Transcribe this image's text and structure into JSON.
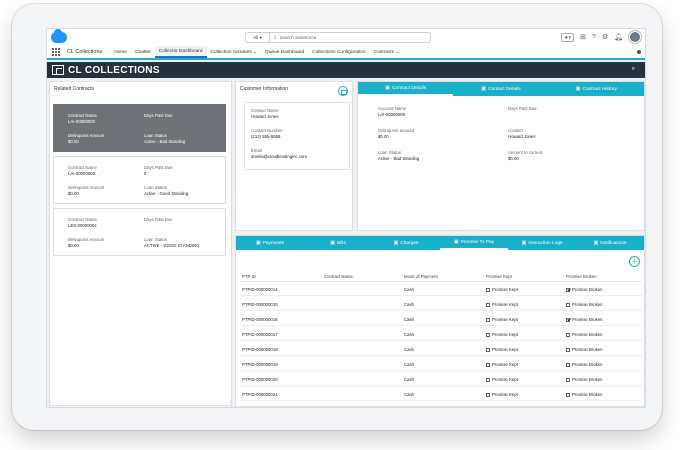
{
  "topbar": {
    "search_scope": "All",
    "search_placeholder": "Search Salesforce"
  },
  "nav": {
    "app_name": "CL Collections",
    "items": [
      "Home",
      "Chatter",
      "Collector Dashboard",
      "Collection Activities",
      "Queue Dashboard",
      "Collections Configuration",
      "Contracts"
    ],
    "active": "Collector Dashboard"
  },
  "header": {
    "title": "CL COLLECTIONS"
  },
  "related": {
    "title": "Related Contracts",
    "cards": [
      {
        "contract_name_label": "Contract Name",
        "contract_name": "LAI-00000000",
        "days_past_due_label": "Days Past Due",
        "days_past_due": "",
        "delinquent_label": "Delinquent Amount",
        "delinquent": "$0.00",
        "status_label": "Loan Status",
        "status": "Active - Bad Standing"
      },
      {
        "contract_name_label": "Contract Name",
        "contract_name": "LAI-00000003",
        "days_past_due_label": "Days Past Due",
        "days_past_due": "0",
        "delinquent_label": "Delinquent Amount",
        "delinquent": "$0.00",
        "status_label": "Loan Status",
        "status": "Active - Good Standing"
      },
      {
        "contract_name_label": "Contract Name",
        "contract_name": "LES-00000004",
        "days_past_due_label": "Days Past Due",
        "days_past_due": "",
        "delinquent_label": "Delinquent Amount",
        "delinquent": "$0.00",
        "status_label": "Loan Status",
        "status": "ACTIVE - GOOD STANDING"
      }
    ]
  },
  "customer": {
    "title": "Customer Information",
    "name_label": "Contact Name",
    "name": "Howard Jones",
    "number_label": "Contact Number",
    "number": "(212) 555-5559",
    "email_label": "Email",
    "email": "amelia@cloudlendinginc.com"
  },
  "contract_tabs": [
    "Contract Details",
    "Contact Details",
    "Contract History"
  ],
  "contract_details": {
    "account_name_label": "Account Name",
    "account_name": "LAI-00000000",
    "days_past_due_label": "Days Past Due",
    "days_past_due": "",
    "delinquent_label": "Delinquent amount",
    "delinquent": "$0.00",
    "contact_label": "Contact",
    "contact": "Howard Jones",
    "loan_status_label": "Loan Status",
    "loan_status": "Active - Bad Standing",
    "amount_label": "Amount to current",
    "amount": "$0.00"
  },
  "lower_tabs": [
    "Payments",
    "Bills",
    "Charges",
    "Promise To Pay",
    "Interaction Logs",
    "Notifications"
  ],
  "promise_table": {
    "columns": [
      "PTP ID",
      "Contract Name",
      "Mode of Payment",
      "Promise Kept",
      "Promise Broken"
    ],
    "rows": [
      {
        "id": "PTPID-000000014",
        "contract": "",
        "mode": "Cash",
        "kept": "Promise Kept",
        "kept_on": false,
        "broken": "Promise Broken",
        "broken_on": true
      },
      {
        "id": "PTPID-000000015",
        "contract": "",
        "mode": "Cash",
        "kept": "Promise Kept",
        "kept_on": false,
        "broken": "Promise Broken",
        "broken_on": false
      },
      {
        "id": "PTPID-000000016",
        "contract": "",
        "mode": "Cash",
        "kept": "Promise Kept",
        "kept_on": false,
        "broken": "Promise Broken",
        "broken_on": true
      },
      {
        "id": "PTPID-000000017",
        "contract": "",
        "mode": "Cash",
        "kept": "Promise Kept",
        "kept_on": false,
        "broken": "Promise Broken",
        "broken_on": false
      },
      {
        "id": "PTPID-000000018",
        "contract": "",
        "mode": "Cash",
        "kept": "Promise Kept",
        "kept_on": false,
        "broken": "Promise Broken",
        "broken_on": false
      },
      {
        "id": "PTPID-000000019",
        "contract": "",
        "mode": "Cash",
        "kept": "Promise Kept",
        "kept_on": false,
        "broken": "Promise Broken",
        "broken_on": false
      },
      {
        "id": "PTPID-000000020",
        "contract": "",
        "mode": "Cash",
        "kept": "Promise Kept",
        "kept_on": false,
        "broken": "Promise Broken",
        "broken_on": false
      },
      {
        "id": "PTPID-000000021",
        "contract": "",
        "mode": "Cash",
        "kept": "Promise Kept",
        "kept_on": false,
        "broken": "Promise Broken",
        "broken_on": false
      }
    ]
  },
  "colors": {
    "accent": "#1ab0c9",
    "header_bg": "#26313d",
    "selected_card": "#6f7276"
  }
}
